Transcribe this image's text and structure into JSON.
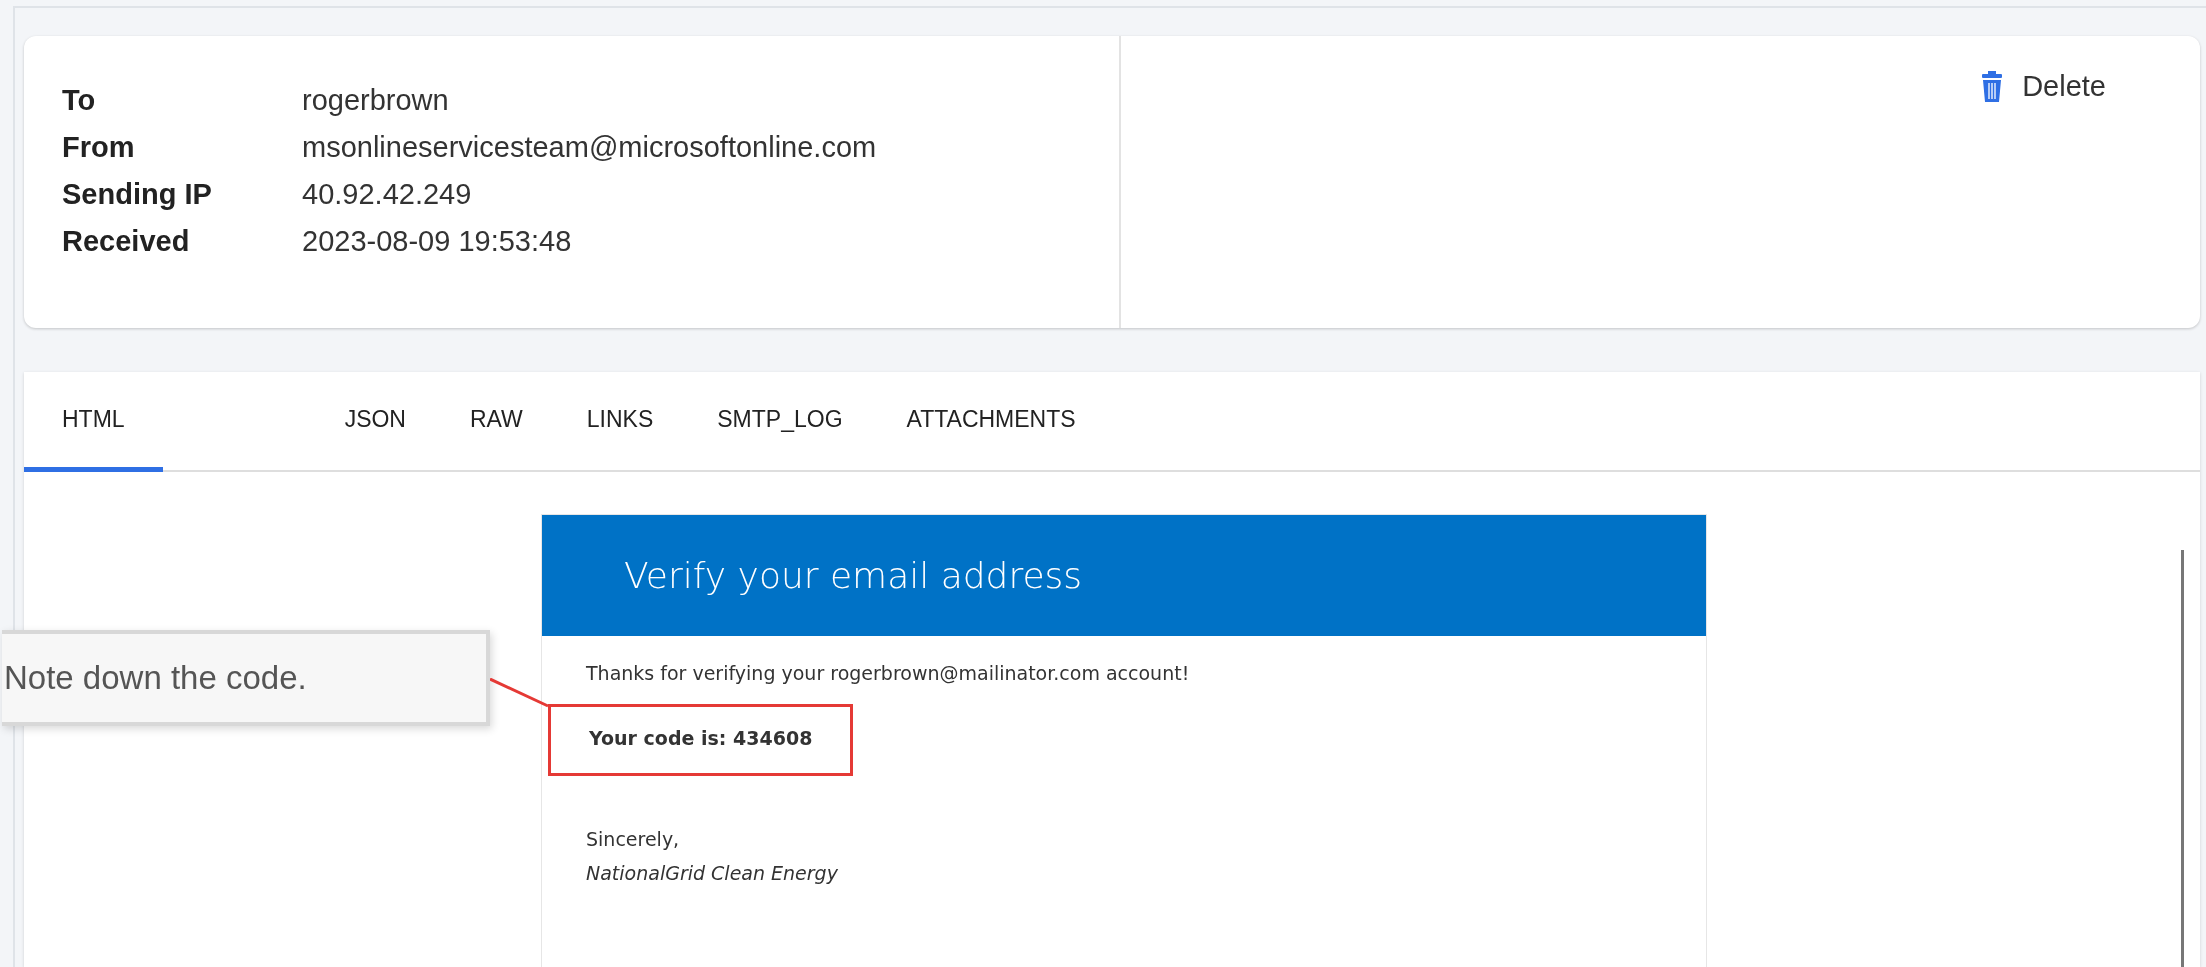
{
  "header": {
    "fields": [
      {
        "label": "To",
        "value": "rogerbrown"
      },
      {
        "label": "From",
        "value": "msonlineservicesteam@microsoftonline.com"
      },
      {
        "label": "Sending IP",
        "value": "40.92.42.249"
      },
      {
        "label": "Received",
        "value": "2023-08-09 19:53:48"
      }
    ],
    "delete_button": "Delete"
  },
  "tabs": [
    {
      "label": "HTML",
      "selected": true
    },
    {
      "label": "JSON",
      "selected": false
    },
    {
      "label": "RAW",
      "selected": false
    },
    {
      "label": "LINKS",
      "selected": false
    },
    {
      "label": "SMTP_LOG",
      "selected": false
    },
    {
      "label": "ATTACHMENTS",
      "selected": false
    }
  ],
  "email": {
    "title": "Verify your email address",
    "intro": "Thanks for verifying your rogerbrown@mailinator.com account!",
    "code_line": "Your code is: 434608",
    "closing": "Sincerely,",
    "signature": "NationalGrid Clean Energy"
  },
  "callout": {
    "text": "Note down the code."
  }
}
